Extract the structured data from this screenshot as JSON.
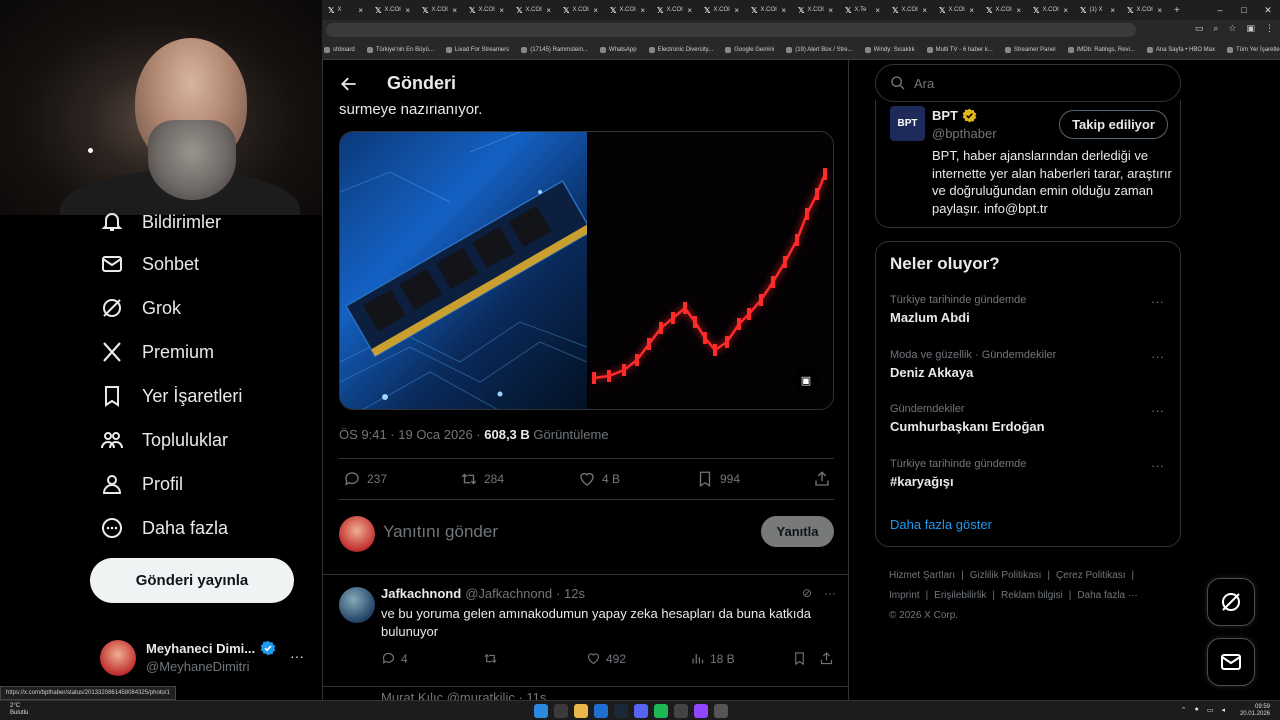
{
  "browser": {
    "tabs": [
      {
        "label": "X"
      },
      {
        "label": "X.COI"
      },
      {
        "label": "X.COI"
      },
      {
        "label": "X.COI"
      },
      {
        "label": "X.COI"
      },
      {
        "label": "X.COI"
      },
      {
        "label": "X.COI"
      },
      {
        "label": "X.COI"
      },
      {
        "label": "X.COI"
      },
      {
        "label": "X.COI"
      },
      {
        "label": "X.COI"
      },
      {
        "label": "X.Te"
      },
      {
        "label": "X.COI"
      },
      {
        "label": "X.COI"
      },
      {
        "label": "X.COI"
      },
      {
        "label": "X.COI"
      },
      {
        "label": "(1) X"
      },
      {
        "label": "X.COI"
      }
    ],
    "bookmarks": [
      "shboard",
      "Türkiye'nin En Büyü...",
      "Livad For Streamers",
      "(17145) Rammstein...",
      "WhatsApp",
      "Electronic Diversity...",
      "Google Gemini",
      "(19) Alert Box / Stre...",
      "Windy: Sıcaklık",
      "Multi TV - 6 haber k...",
      "Streamer Panel",
      "IMDb: Ratings, Revi...",
      "Ana Sayfa • HBO Max",
      "Tüm Yer İşaretleri"
    ]
  },
  "nav": {
    "items": [
      {
        "label": "Bildirimler",
        "icon": "bell-icon"
      },
      {
        "label": "Sohbet",
        "icon": "mail-icon"
      },
      {
        "label": "Grok",
        "icon": "grok-icon"
      },
      {
        "label": "Premium",
        "icon": "x-logo-icon"
      },
      {
        "label": "Yer İşaretleri",
        "icon": "bookmark-icon"
      },
      {
        "label": "Topluluklar",
        "icon": "communities-icon"
      },
      {
        "label": "Profil",
        "icon": "person-icon"
      },
      {
        "label": "Daha fazla",
        "icon": "more-circle-icon"
      }
    ],
    "post_button": "Gönderi yayınla",
    "account": {
      "name": "Meyhaneci Dimi...",
      "handle": "@MeyhaneDimitri"
    }
  },
  "main": {
    "title": "Gönderi",
    "tweet_text_tail": "sürmeye hazırlanıyor.",
    "meta": {
      "time": "ÖS 9:41 · 19 Oca 2026 · ",
      "views": "608,3 B",
      "views_label": " Görüntüleme"
    },
    "actions": {
      "replies": "237",
      "reposts": "284",
      "likes": "4 B",
      "bookmarks": "994"
    },
    "reply_placeholder": "Yanıtını gönder",
    "reply_button": "Yanıtla",
    "reply": {
      "name": "Jafkachnond",
      "handle": "@Jafkachnond",
      "time": "· 12s",
      "text": "ve bu yoruma gelen amınakodumun yapay zeka hesapları da buna katkıda bulunuyor",
      "replies": "4",
      "likes": "492",
      "views": "18 B"
    },
    "next_reply_partial": "Murat Kılıç @muratkilic · 11s"
  },
  "sidebar": {
    "search_placeholder": "Ara",
    "profile": {
      "name": "BPT",
      "handle": "@bpthaber",
      "follow_label": "Takip ediliyor",
      "bio": "BPT, haber ajanslarından derlediği ve internette yer alan haberleri tarar, araştırır ve doğruluğundan emin olduğu zaman paylaşır. info@bpt.tr",
      "logo_text": "BPT"
    },
    "trends_title": "Neler oluyor?",
    "trends": [
      {
        "context": "Türkiye tarihinde gündemde",
        "name": "Mazlum Abdi"
      },
      {
        "context": "Moda ve güzellik · Gündemdekiler",
        "name": "Deniz Akkaya"
      },
      {
        "context": "Gündemdekiler",
        "name": "Cumhurbaşkanı Erdoğan"
      },
      {
        "context": "Türkiye tarihinde gündemde",
        "name": "#karyağışı"
      }
    ],
    "show_more": "Daha fazla göster",
    "footer": [
      "Hizmet Şartları",
      "|",
      "Gizlilik Politikası",
      "|",
      "Çerez Politikası",
      "|",
      "Imprint",
      "|",
      "Erişilebilirlik",
      "|",
      "Reklam bilgisi",
      "|",
      "Daha fazla ···",
      "© 2026 X Corp."
    ]
  },
  "status_url": "https://x.com/bpthaber/status/2013320861458084325/photo/1",
  "taskbar": {
    "weather_temp": "2°C",
    "weather_desc": "Bulutlu",
    "time": "09:59",
    "date": "20.01.2026"
  },
  "colors": {
    "accent": "#1d9bf0",
    "text": "#e7e9ea",
    "muted": "#71767b",
    "border": "#2f3336",
    "chart_red": "#ff2a2a"
  }
}
